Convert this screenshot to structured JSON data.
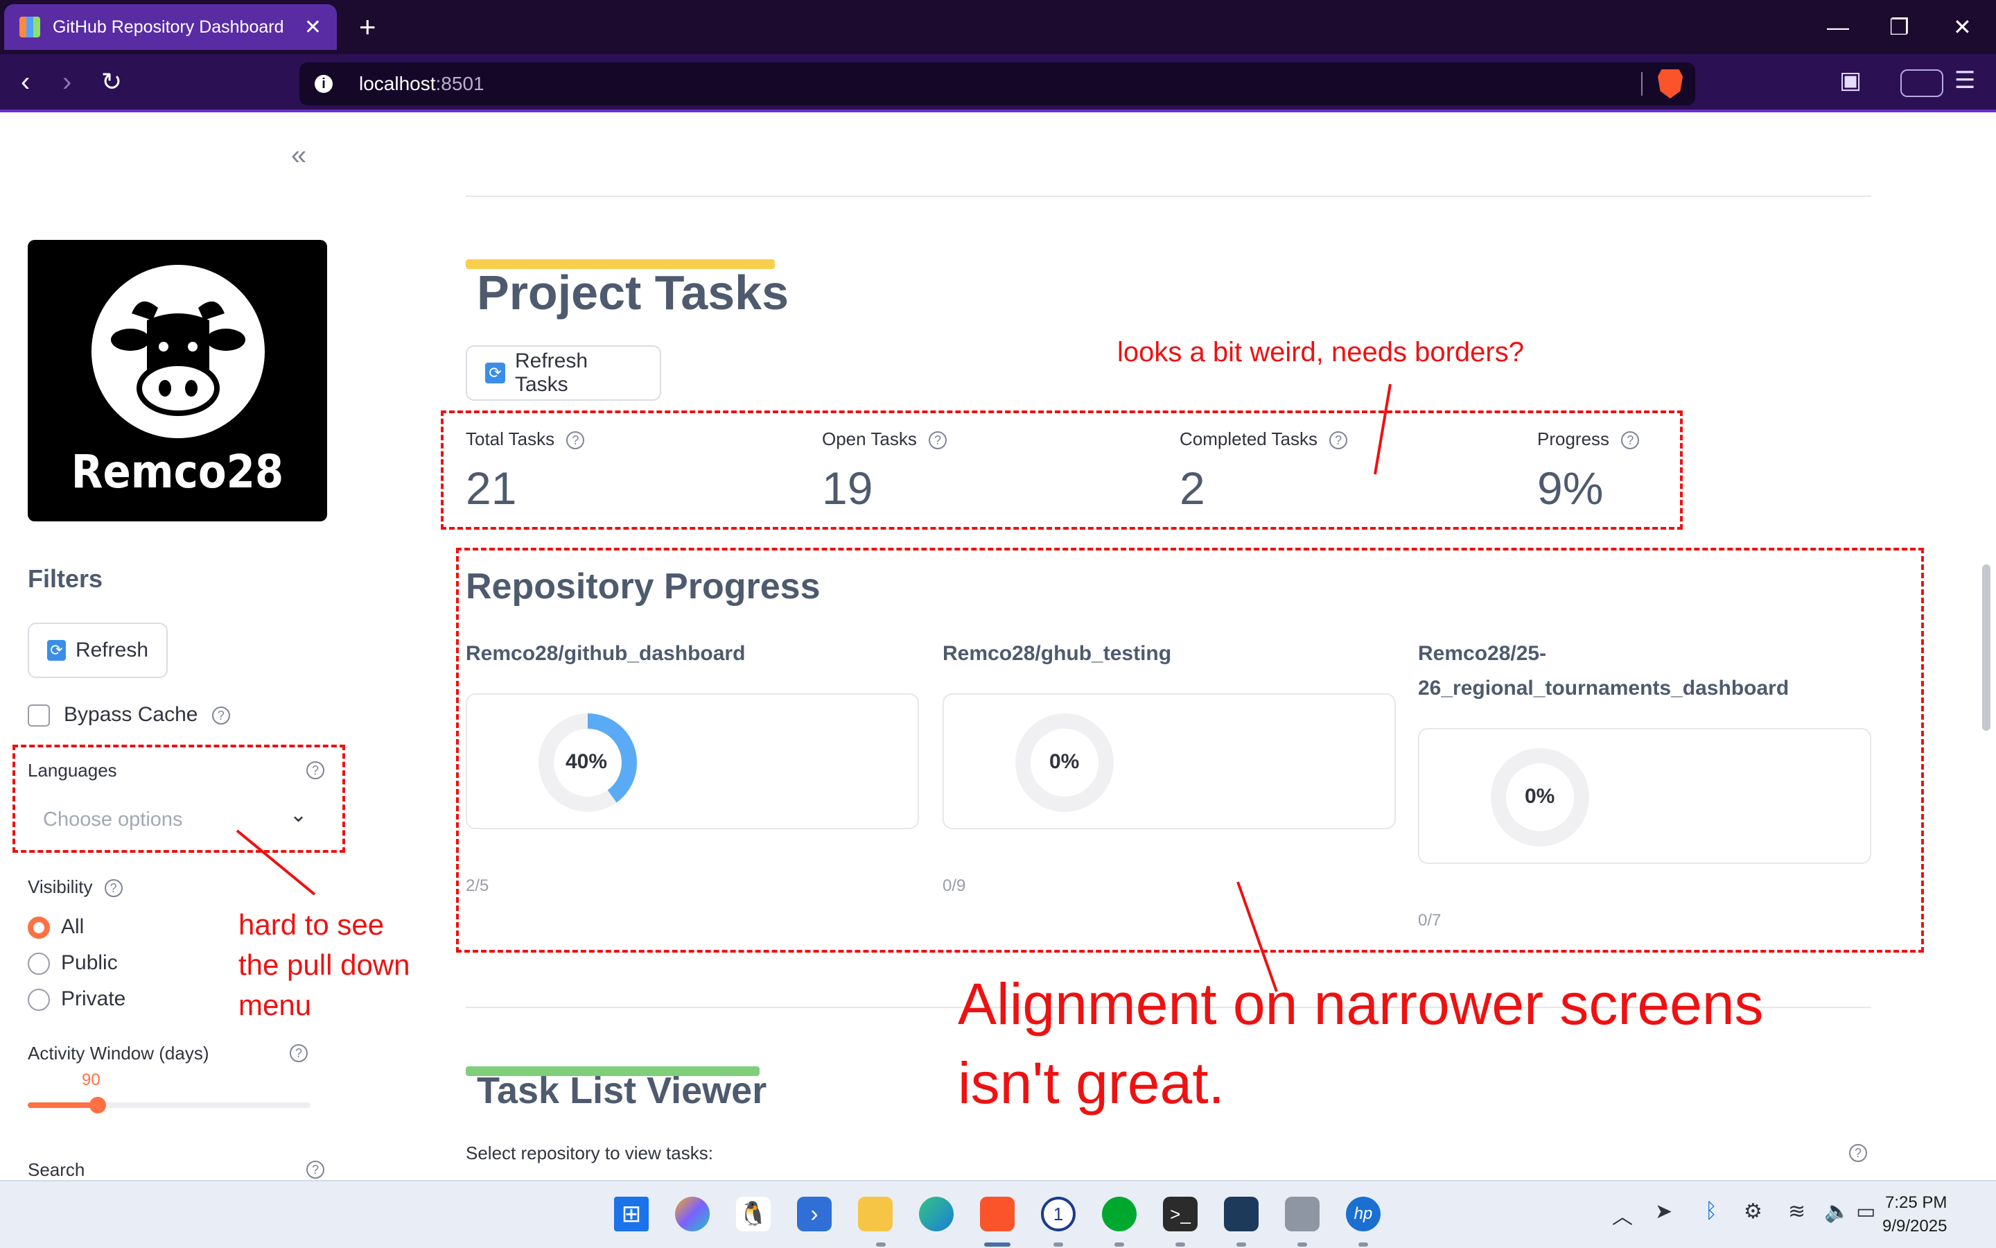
{
  "browser": {
    "tab_title": "GitHub Repository Dashboard",
    "tab_close": "✕",
    "new_tab": "+",
    "url_host": "localhost",
    "url_port": ":8501",
    "window_minimize": "—",
    "window_restore": "❐",
    "window_close": "✕"
  },
  "sidebar": {
    "collapse": "«",
    "logo_text": "Remco28",
    "filters_heading": "Filters",
    "refresh_label": "Refresh",
    "bypass_cache_label": "Bypass Cache",
    "languages_label": "Languages",
    "languages_placeholder": "Choose options",
    "visibility_label": "Visibility",
    "visibility_options": [
      "All",
      "Public",
      "Private"
    ],
    "visibility_selected": "All",
    "activity_label": "Activity Window (days)",
    "activity_value": "90",
    "activity_min": 0,
    "activity_max": 365,
    "search_label": "Search",
    "help_glyph": "?"
  },
  "main": {
    "project_tasks_title": "Project Tasks",
    "refresh_tasks_label": "Refresh Tasks",
    "metrics": [
      {
        "label": "Total Tasks",
        "value": "21"
      },
      {
        "label": "Open Tasks",
        "value": "19"
      },
      {
        "label": "Completed Tasks",
        "value": "2"
      },
      {
        "label": "Progress",
        "value": "9%"
      }
    ],
    "repo_progress_title": "Repository Progress",
    "repos": [
      {
        "name": "Remco28/github_dashboard",
        "percent_label": "40%",
        "percent": 40,
        "count": "2/5"
      },
      {
        "name": "Remco28/ghub_testing",
        "percent_label": "0%",
        "percent": 0,
        "count": "0/9"
      },
      {
        "name_line1": "Remco28/25-",
        "name_line2": "26_regional_tournaments_dashboard",
        "percent_label": "0%",
        "percent": 0,
        "count": "0/7"
      }
    ],
    "task_list_title": "Task List Viewer",
    "select_repo_caption": "Select repository to view tasks:"
  },
  "annotations": {
    "metrics_note": "looks a bit weird, needs borders?",
    "dropdown_note_1": "hard to see",
    "dropdown_note_2": "the pull down",
    "dropdown_note_3": "menu",
    "alignment_note_1": "Alignment on narrower screens",
    "alignment_note_2": "isn't great."
  },
  "taskbar": {
    "time": "7:25 PM",
    "date": "9/9/2025"
  },
  "colors": {
    "accent": "#ff7043",
    "heading": "#4e5a6e",
    "annotation": "#ee1111",
    "progress_ring": "#5aaaf5",
    "project_tasks_bar": "#f7cf4d",
    "task_list_bar": "#7fcf7a"
  }
}
